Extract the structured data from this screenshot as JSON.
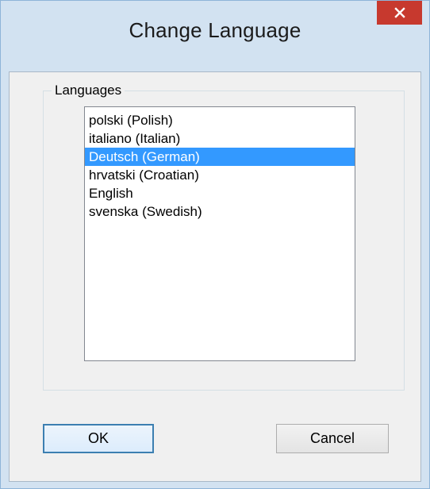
{
  "window": {
    "title": "Change Language",
    "close_icon": "close-icon"
  },
  "languages_group": {
    "label": "Languages",
    "items": [
      {
        "label": "polski (Polish)",
        "selected": false
      },
      {
        "label": "italiano (Italian)",
        "selected": false
      },
      {
        "label": "Deutsch (German)",
        "selected": true
      },
      {
        "label": "hrvatski (Croatian)",
        "selected": false
      },
      {
        "label": "English",
        "selected": false
      },
      {
        "label": "svenska (Swedish)",
        "selected": false
      }
    ]
  },
  "buttons": {
    "ok_label": "OK",
    "cancel_label": "Cancel"
  },
  "colors": {
    "titlebar": "#d2e2f1",
    "close_button": "#c7392e",
    "selection": "#3399ff",
    "dialog_background": "#f0f0f0"
  }
}
